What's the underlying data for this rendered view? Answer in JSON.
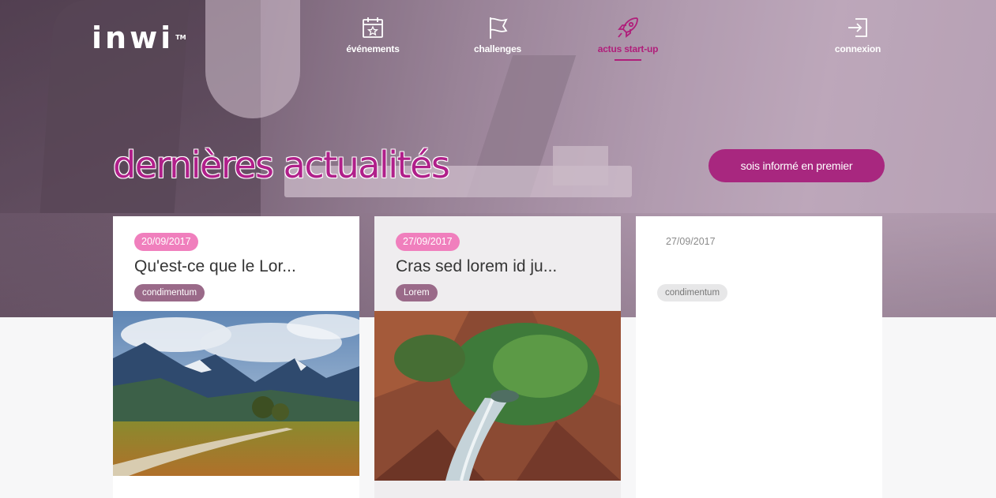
{
  "brand": {
    "logo": "inwi",
    "tm": "TM"
  },
  "nav": [
    {
      "label": "événements",
      "icon": "calendar-star-icon",
      "active": false
    },
    {
      "label": "challenges",
      "icon": "flag-icon",
      "active": false
    },
    {
      "label": "actus start-up",
      "icon": "rocket-icon",
      "active": true
    },
    {
      "label": "connexion",
      "icon": "login-icon",
      "active": false
    }
  ],
  "hero": {
    "headline": "dernières actualités",
    "cta_label": "sois informé en premier"
  },
  "colors": {
    "accent": "#b0208a",
    "cta": "#a8277f",
    "date_badge": "#f07fbd",
    "tag": "#9a6a89"
  },
  "articles": [
    {
      "date": "20/09/2017",
      "title": "Qu'est-ce que le Lor...",
      "tag": "condimentum",
      "image": "mountain-road-landscape"
    },
    {
      "date": "27/09/2017",
      "title": "Cras sed lorem id ju...",
      "tag": "Lorem",
      "image": "canyon-waterfall-aerial"
    },
    {
      "date": "27/09/2017",
      "title": "",
      "tag": "condimentum",
      "image": ""
    }
  ]
}
